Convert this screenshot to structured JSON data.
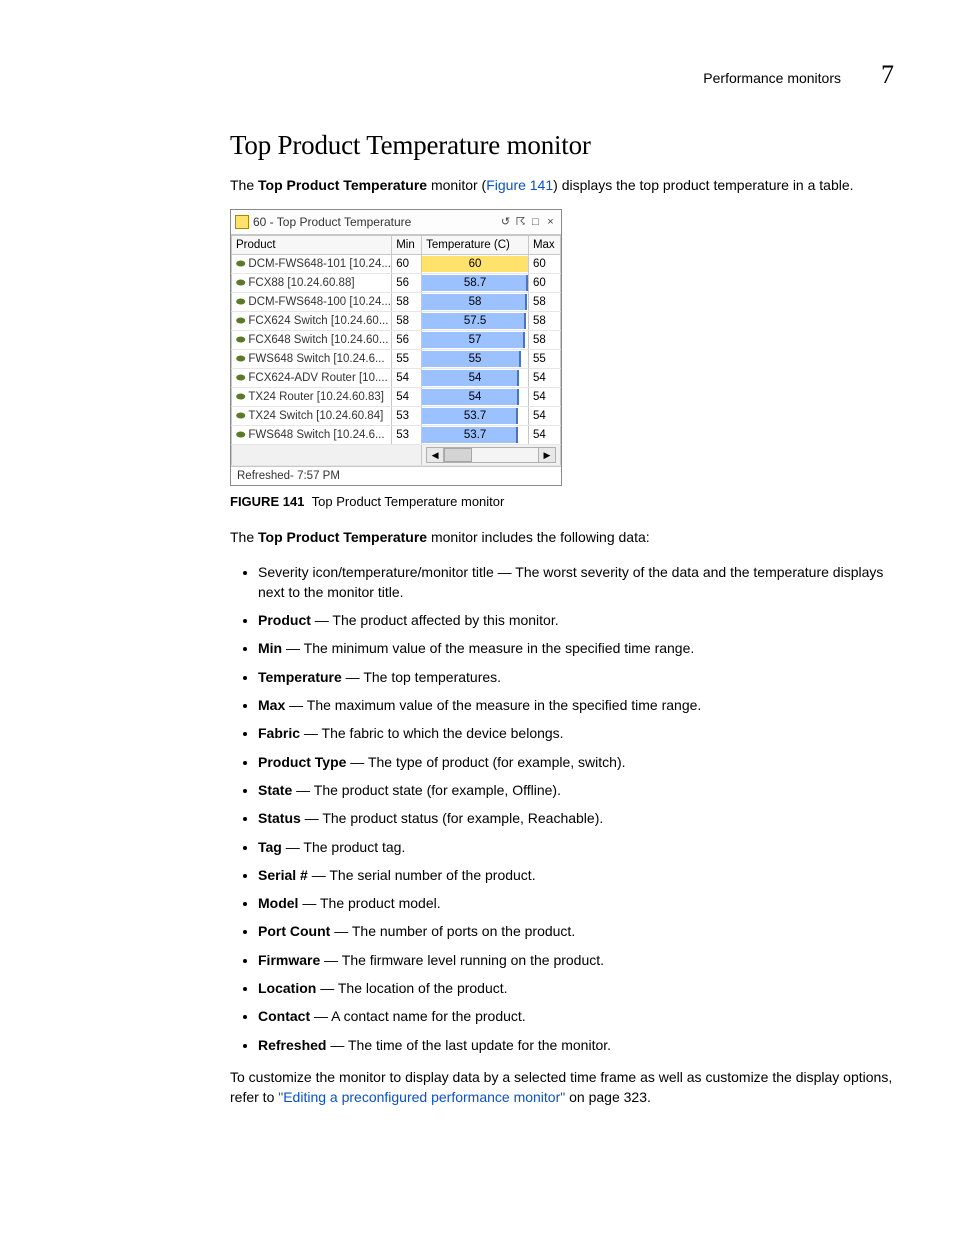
{
  "header": {
    "section": "Performance monitors",
    "chapter": "7"
  },
  "title": "Top Product Temperature monitor",
  "intro": {
    "pre": "The ",
    "bold": "Top Product Temperature",
    "mid": " monitor (",
    "link": "Figure 141",
    "post": ") displays the top product temperature in a table."
  },
  "monitor": {
    "title": "60 - Top Product Temperature",
    "columns": {
      "product": "Product",
      "min": "Min",
      "temp": "Temperature (C)",
      "max": "Max"
    },
    "rows": [
      {
        "product": "DCM-FWS648-101 [10.24....",
        "min": "60",
        "temp": "60",
        "max": "60",
        "pct": 100,
        "warn": true
      },
      {
        "product": "FCX88 [10.24.60.88]",
        "min": "56",
        "temp": "58.7",
        "max": "60",
        "pct": 98,
        "warn": false
      },
      {
        "product": "DCM-FWS648-100 [10.24....",
        "min": "58",
        "temp": "58",
        "max": "58",
        "pct": 97,
        "warn": false
      },
      {
        "product": "FCX624 Switch [10.24.60...",
        "min": "58",
        "temp": "57.5",
        "max": "58",
        "pct": 96,
        "warn": false
      },
      {
        "product": "FCX648 Switch [10.24.60...",
        "min": "56",
        "temp": "57",
        "max": "58",
        "pct": 95,
        "warn": false
      },
      {
        "product": "FWS648 Switch [10.24.6...",
        "min": "55",
        "temp": "55",
        "max": "55",
        "pct": 92,
        "warn": false
      },
      {
        "product": "FCX624-ADV Router [10....",
        "min": "54",
        "temp": "54",
        "max": "54",
        "pct": 90,
        "warn": false
      },
      {
        "product": "TX24 Router [10.24.60.83]",
        "min": "54",
        "temp": "54",
        "max": "54",
        "pct": 90,
        "warn": false
      },
      {
        "product": "TX24 Switch [10.24.60.84]",
        "min": "53",
        "temp": "53.7",
        "max": "54",
        "pct": 89,
        "warn": false
      },
      {
        "product": "FWS648 Switch [10.24.6...",
        "min": "53",
        "temp": "53.7",
        "max": "54",
        "pct": 89,
        "warn": false
      }
    ],
    "refreshed": "Refreshed- 7:57 PM"
  },
  "figure": {
    "label": "FIGURE 141",
    "caption": "Top Product Temperature monitor"
  },
  "para2": {
    "pre": "The ",
    "bold": "Top Product Temperature",
    "post": " monitor includes the following data:"
  },
  "bullets": [
    {
      "plain": "Severity icon/temperature/monitor title — The worst severity of the data and the temperature displays next to the monitor title."
    },
    {
      "term": "Product",
      "sep": " — ",
      "desc": "The product affected by this monitor."
    },
    {
      "term": "Min",
      "sep": " — ",
      "desc": "The minimum value of the measure in the specified time range."
    },
    {
      "term": "Temperature",
      "sep": " — ",
      "desc": "The top temperatures."
    },
    {
      "term": "Max",
      "sep": " — ",
      "desc": "The maximum value of the measure in the specified time range."
    },
    {
      "term": "Fabric",
      "sep": " — ",
      "desc": "The fabric to which the device belongs."
    },
    {
      "term": "Product Type",
      "sep": " — ",
      "desc": "The type of product (for example, switch)."
    },
    {
      "term": "State",
      "sep": " — ",
      "desc": "The product state (for example, Offline)."
    },
    {
      "term": "Status",
      "sep": " — ",
      "desc": "The product status (for example, Reachable)."
    },
    {
      "term": "Tag",
      "sep": " — ",
      "desc": "The product tag."
    },
    {
      "term": "Serial #",
      "sep": " — ",
      "desc": "The serial number of the product."
    },
    {
      "term": "Model",
      "sep": " — ",
      "desc": "The product model."
    },
    {
      "term": "Port Count",
      "sep": " — ",
      "desc": "The number of ports on the product."
    },
    {
      "term": "Firmware",
      "sep": " — ",
      "desc": "The firmware level running on the product."
    },
    {
      "term": "Location",
      "sep": " — ",
      "desc": "The location of the product."
    },
    {
      "term": "Contact",
      "sep": " — ",
      "desc": "A contact name for the product."
    },
    {
      "term": "Refreshed",
      "sep": " — ",
      "desc": "The time of the last update for the monitor."
    }
  ],
  "closing": {
    "pre": "To customize the monitor to display data by a selected time frame as well as customize the display options, refer to ",
    "link": "\"Editing a preconfigured performance monitor\"",
    "post": " on page 323."
  }
}
